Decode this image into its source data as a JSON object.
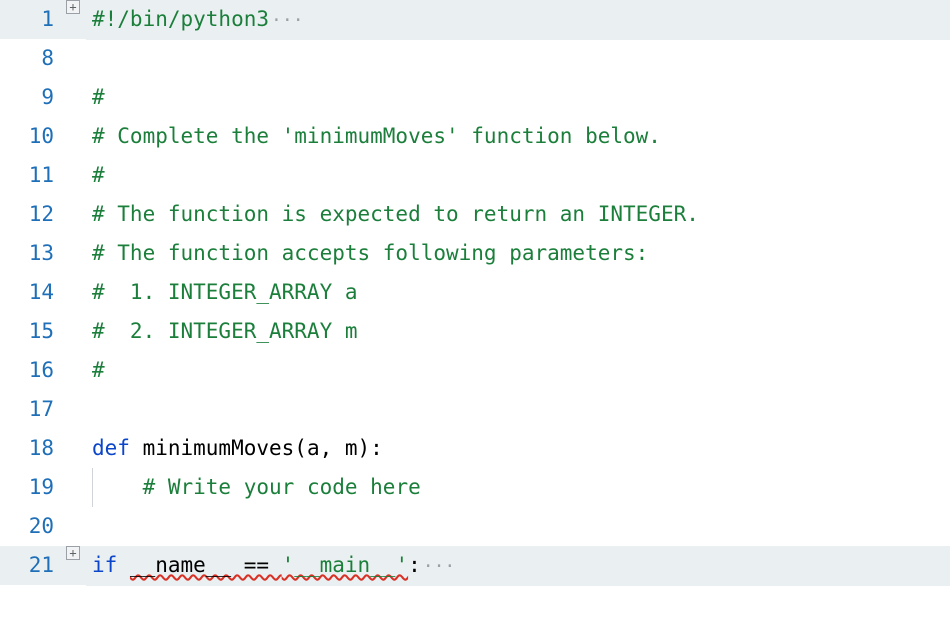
{
  "lines": [
    {
      "num": 1,
      "fold": true,
      "foldedBg": true,
      "tokens": [
        {
          "t": "#!/bin/python3",
          "cls": "tok-comment"
        },
        {
          "t": "···",
          "cls": "tok-dots"
        }
      ]
    },
    {
      "num": 8,
      "fold": false,
      "foldedBg": false,
      "tokens": []
    },
    {
      "num": 9,
      "fold": false,
      "foldedBg": false,
      "tokens": [
        {
          "t": "#",
          "cls": "tok-comment"
        }
      ]
    },
    {
      "num": 10,
      "fold": false,
      "foldedBg": false,
      "tokens": [
        {
          "t": "# Complete the 'minimumMoves' function below.",
          "cls": "tok-comment"
        }
      ]
    },
    {
      "num": 11,
      "fold": false,
      "foldedBg": false,
      "tokens": [
        {
          "t": "#",
          "cls": "tok-comment"
        }
      ]
    },
    {
      "num": 12,
      "fold": false,
      "foldedBg": false,
      "tokens": [
        {
          "t": "# The function is expected to return an INTEGER.",
          "cls": "tok-comment"
        }
      ]
    },
    {
      "num": 13,
      "fold": false,
      "foldedBg": false,
      "tokens": [
        {
          "t": "# The function accepts following parameters:",
          "cls": "tok-comment"
        }
      ]
    },
    {
      "num": 14,
      "fold": false,
      "foldedBg": false,
      "tokens": [
        {
          "t": "#  1. INTEGER_ARRAY a",
          "cls": "tok-comment"
        }
      ]
    },
    {
      "num": 15,
      "fold": false,
      "foldedBg": false,
      "tokens": [
        {
          "t": "#  2. INTEGER_ARRAY m",
          "cls": "tok-comment"
        }
      ]
    },
    {
      "num": 16,
      "fold": false,
      "foldedBg": false,
      "tokens": [
        {
          "t": "#",
          "cls": "tok-comment"
        }
      ]
    },
    {
      "num": 17,
      "fold": false,
      "foldedBg": false,
      "tokens": []
    },
    {
      "num": 18,
      "fold": false,
      "foldedBg": false,
      "tokens": [
        {
          "t": "def ",
          "cls": "tok-kw"
        },
        {
          "t": "minimumMoves",
          "cls": "tok-fn"
        },
        {
          "t": "(a, m):",
          "cls": "tok-paren"
        }
      ]
    },
    {
      "num": 19,
      "fold": false,
      "foldedBg": false,
      "indentGuide": true,
      "tokens": [
        {
          "t": "    ",
          "cls": "tok-plain"
        },
        {
          "t": "# Write your code here",
          "cls": "tok-comment"
        }
      ]
    },
    {
      "num": 20,
      "fold": false,
      "foldedBg": false,
      "tokens": []
    },
    {
      "num": 21,
      "fold": true,
      "foldedBg": true,
      "tokens": [
        {
          "t": "if ",
          "cls": "tok-kw"
        },
        {
          "t": "__name__ == ",
          "cls": "tok-plain",
          "squiggle": true
        },
        {
          "t": "'__main__'",
          "cls": "tok-str",
          "squiggle": true
        },
        {
          "t": ":",
          "cls": "tok-plain"
        },
        {
          "t": "···",
          "cls": "tok-dots"
        }
      ]
    }
  ],
  "foldIconGlyph": "+"
}
